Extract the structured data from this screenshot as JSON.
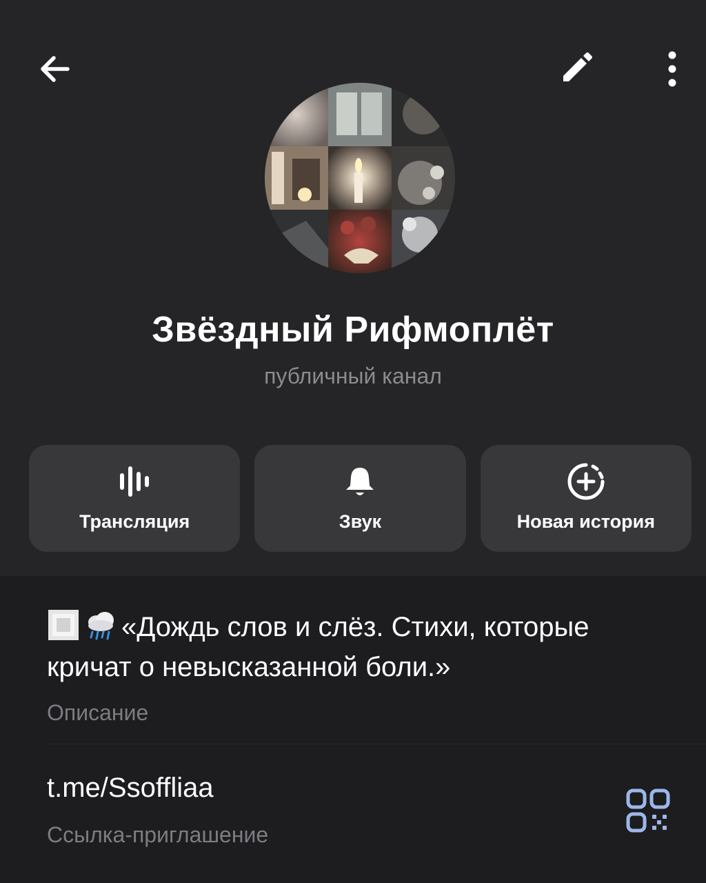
{
  "header": {
    "back_icon": "arrow-left-icon",
    "edit_icon": "pencil-icon",
    "more_icon": "dots-vertical-icon"
  },
  "channel": {
    "title": "Звёздный Рифмоплёт",
    "subtitle": "публичный канал"
  },
  "actions": [
    {
      "label": "Трансляция",
      "icon": "voice-chat-icon"
    },
    {
      "label": "Звук",
      "icon": "bell-icon"
    },
    {
      "label": "Новая история",
      "icon": "add-story-icon"
    }
  ],
  "about": {
    "description": "«Дождь слов и слёз. Стихи, которые кричат о невысказанной боли.»",
    "description_caption": "Описание",
    "link": "t.me/Ssoffliaa",
    "link_caption": "Ссылка-приглашение",
    "qr_icon": "qr-code-icon"
  },
  "colors": {
    "header_bg": "#252527",
    "page_bg": "#1d1d1f",
    "button_bg": "#38383b",
    "secondary_text": "#8b8b90",
    "qr_accent": "#9db7ea"
  }
}
